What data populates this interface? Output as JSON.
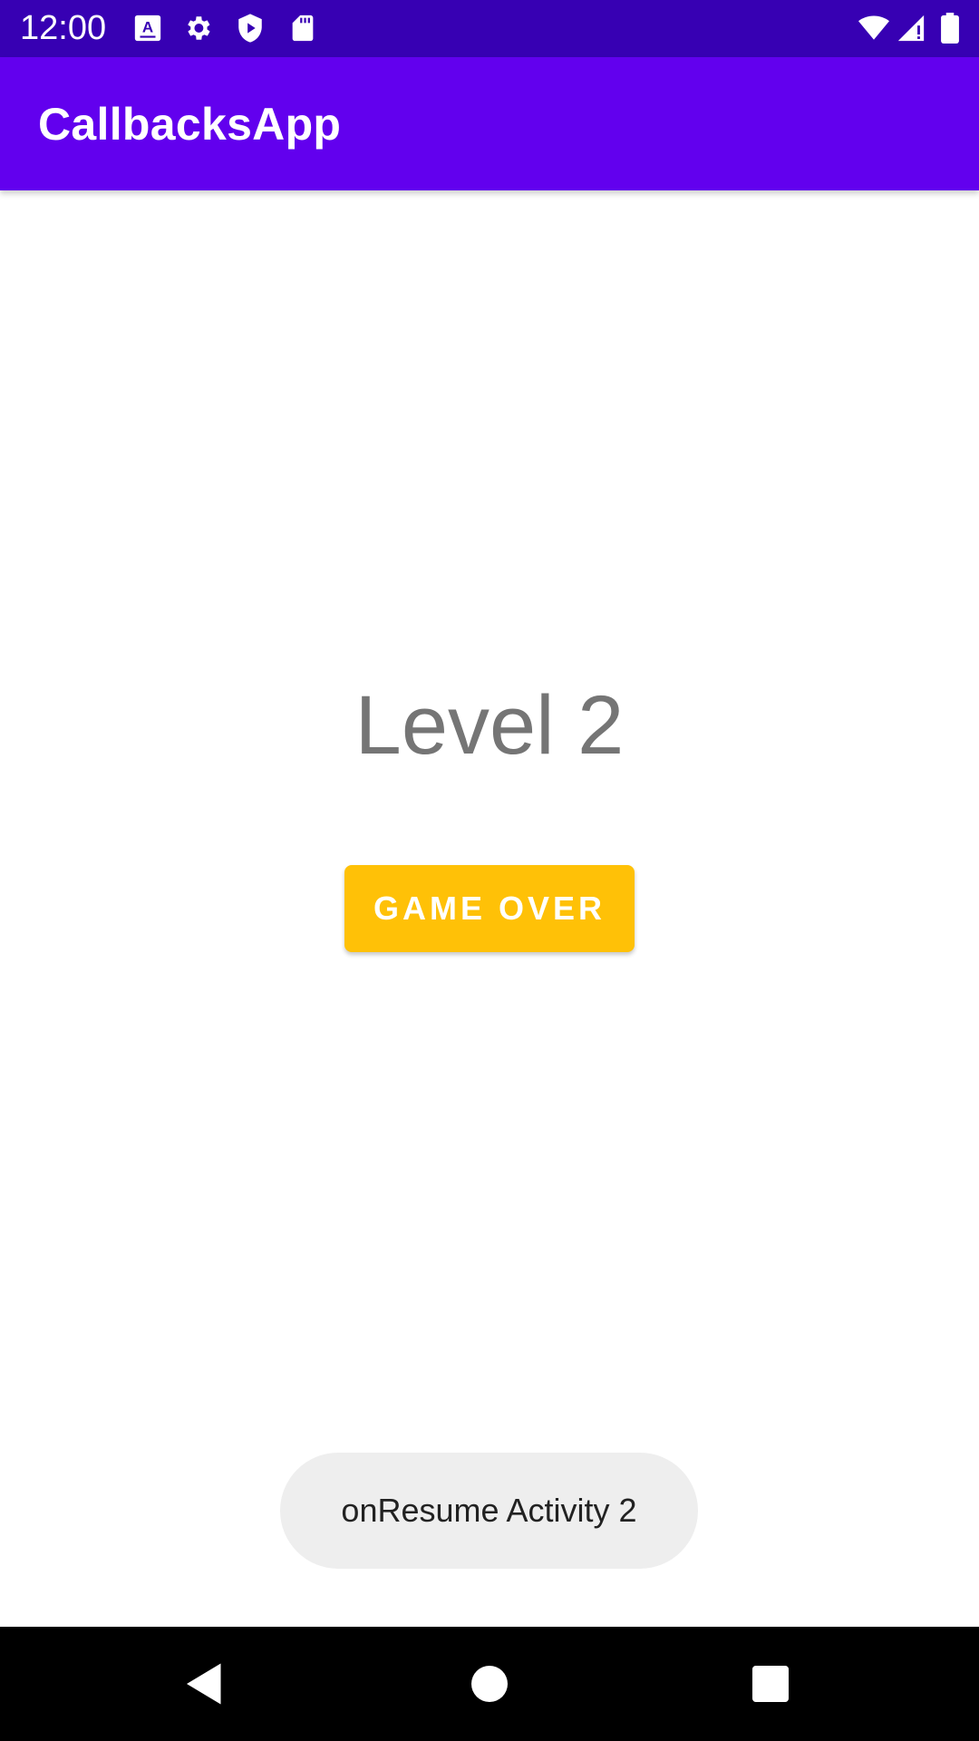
{
  "status_bar": {
    "time": "12:00",
    "left_icons": [
      "keyboard-a-icon",
      "gear-icon",
      "shield-play-icon",
      "sd-card-icon"
    ],
    "right_icons": [
      "wifi-icon",
      "signal-icon",
      "battery-icon"
    ],
    "background_color": "#3700b3"
  },
  "app_bar": {
    "title": "CallbacksApp",
    "background_color": "#6200ee"
  },
  "main": {
    "level_text": "Level 2",
    "game_over_label": "GAME OVER",
    "button_color": "#ffc107"
  },
  "toast": {
    "message": "onResume Activity 2"
  },
  "nav_bar": {
    "buttons": [
      "back-icon",
      "home-icon",
      "recents-icon"
    ]
  }
}
